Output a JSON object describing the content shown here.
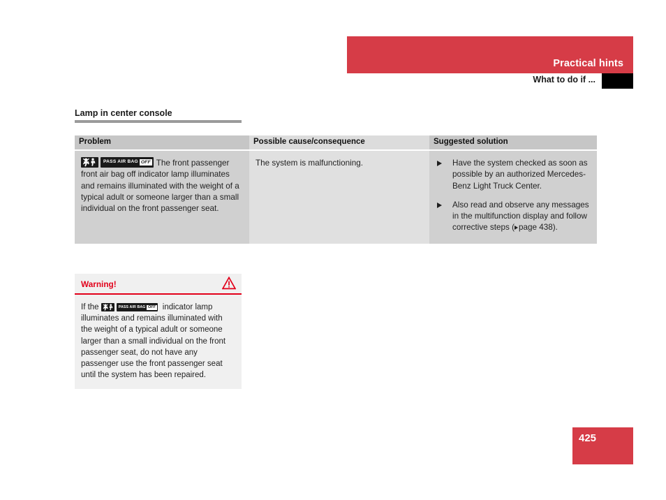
{
  "header": {
    "chapter_title": "Practical hints",
    "section_title": "What to do if ...",
    "tab_marker": ""
  },
  "section": {
    "heading": "Lamp in center console"
  },
  "table": {
    "columns": [
      "Problem",
      "Possible cause/consequence",
      "Suggested solution"
    ],
    "rows": [
      {
        "problem_indicator": {
          "symbol_label": "airbag-child-seat-symbol",
          "text_label": "PASS AIR BAG",
          "state_label": "OFF"
        },
        "problem_text": "The front passenger front air bag off indicator lamp illuminates and remains illuminated with the weight of a typical adult or someone larger than a small individual on the front passenger seat.",
        "cause": "The system is malfunctioning.",
        "solutions": [
          {
            "text": "Have the system checked as soon as possible by an authorized Mercedes-Benz Light Truck Center."
          },
          {
            "text_before_ref": "Also read and observe any messages in the multifunction display and follow corrective steps (",
            "reference": "page 438",
            "text_after_ref": ")."
          }
        ]
      }
    ]
  },
  "warning": {
    "title": "Warning!",
    "icon": "warning-triangle-icon",
    "text_before_lamp": "If the",
    "lamp": {
      "symbol_label": "airbag-child-seat-symbol",
      "text_label": "PASS AIR BAG",
      "state_label": "OFF"
    },
    "text_after_lamp": "indicator lamp illuminates and remains illuminated with the weight of a typical adult or someone larger than a small individual on the front passenger seat, do not have any passenger use the front passenger seat until the system has been repaired."
  },
  "footer": {
    "page_number": "425"
  },
  "colors": {
    "brand_red": "#d63c47",
    "warning_red": "#e2001a",
    "table_col_dark": "#d0d0d0",
    "table_col_light": "#e0e0e0",
    "heading_rule": "#9a9a9a"
  }
}
